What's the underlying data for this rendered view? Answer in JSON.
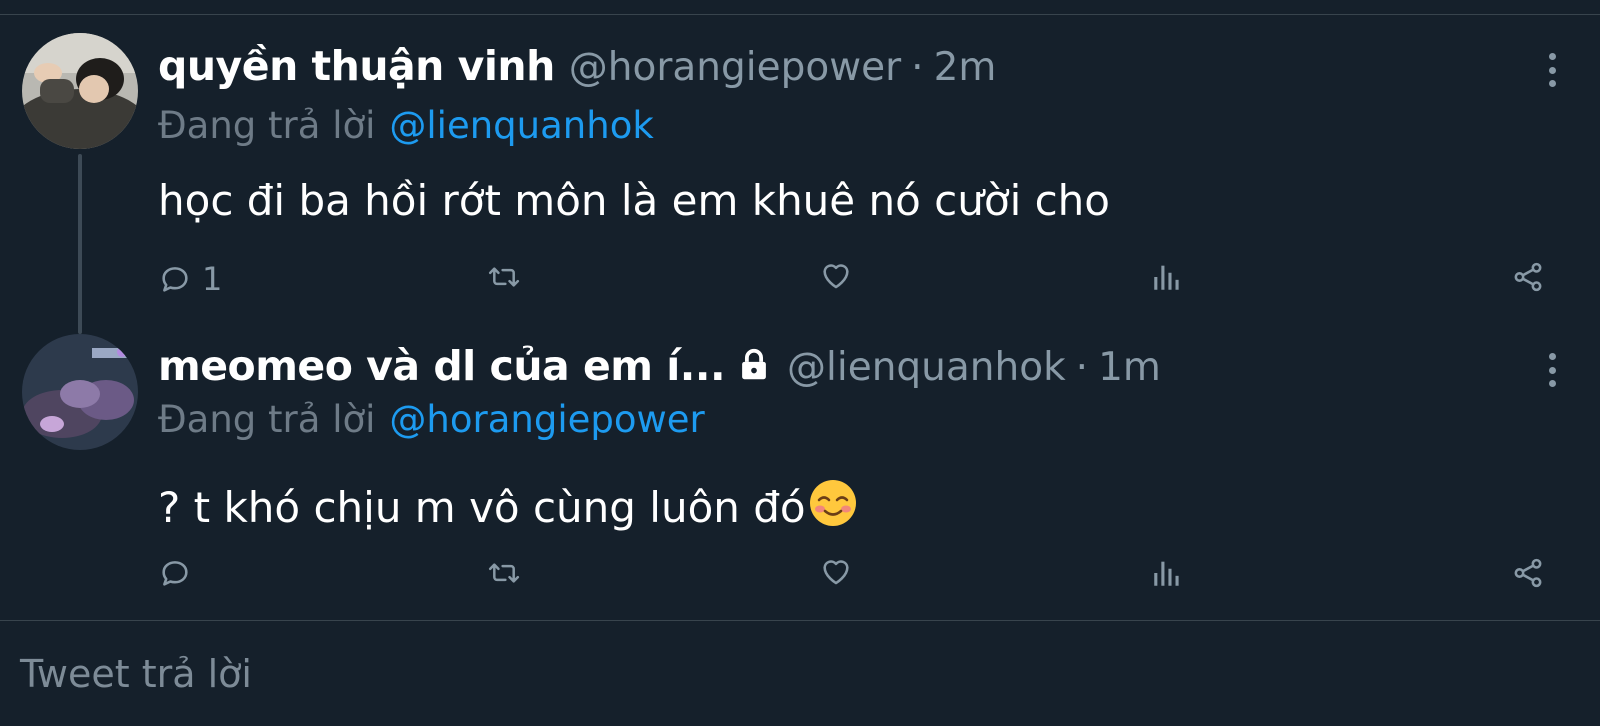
{
  "tweets": [
    {
      "display_name": "quyền thuận vinh",
      "handle": "@horangiepower",
      "separator": "·",
      "time": "2m",
      "replying_label": "Đang trả lời",
      "replying_to": "@lienquanhok",
      "text": "học đi ba hồi rớt môn là em khuê nó cười cho",
      "reply_count": "1",
      "protected": false
    },
    {
      "display_name": "meomeo và dl của em í...",
      "handle": "@lienquanhok",
      "separator": "·",
      "time": "1m",
      "replying_label": "Đang trả lời",
      "replying_to": "@horangiepower",
      "text": "? t khó chịu m vô cùng luôn đó",
      "emoji": "☺️",
      "reply_count": "",
      "protected": true
    }
  ],
  "compose": {
    "placeholder": "Tweet trả lời"
  },
  "colors": {
    "background": "#15202b",
    "secondary_text": "#8899a6",
    "link": "#1d9bf0",
    "divider": "#38444d"
  },
  "icons": {
    "reply": "reply-icon",
    "retweet": "retweet-icon",
    "like": "heart-icon",
    "analytics": "analytics-icon",
    "share": "share-icon",
    "more": "more-vertical-icon",
    "lock": "lock-icon"
  }
}
